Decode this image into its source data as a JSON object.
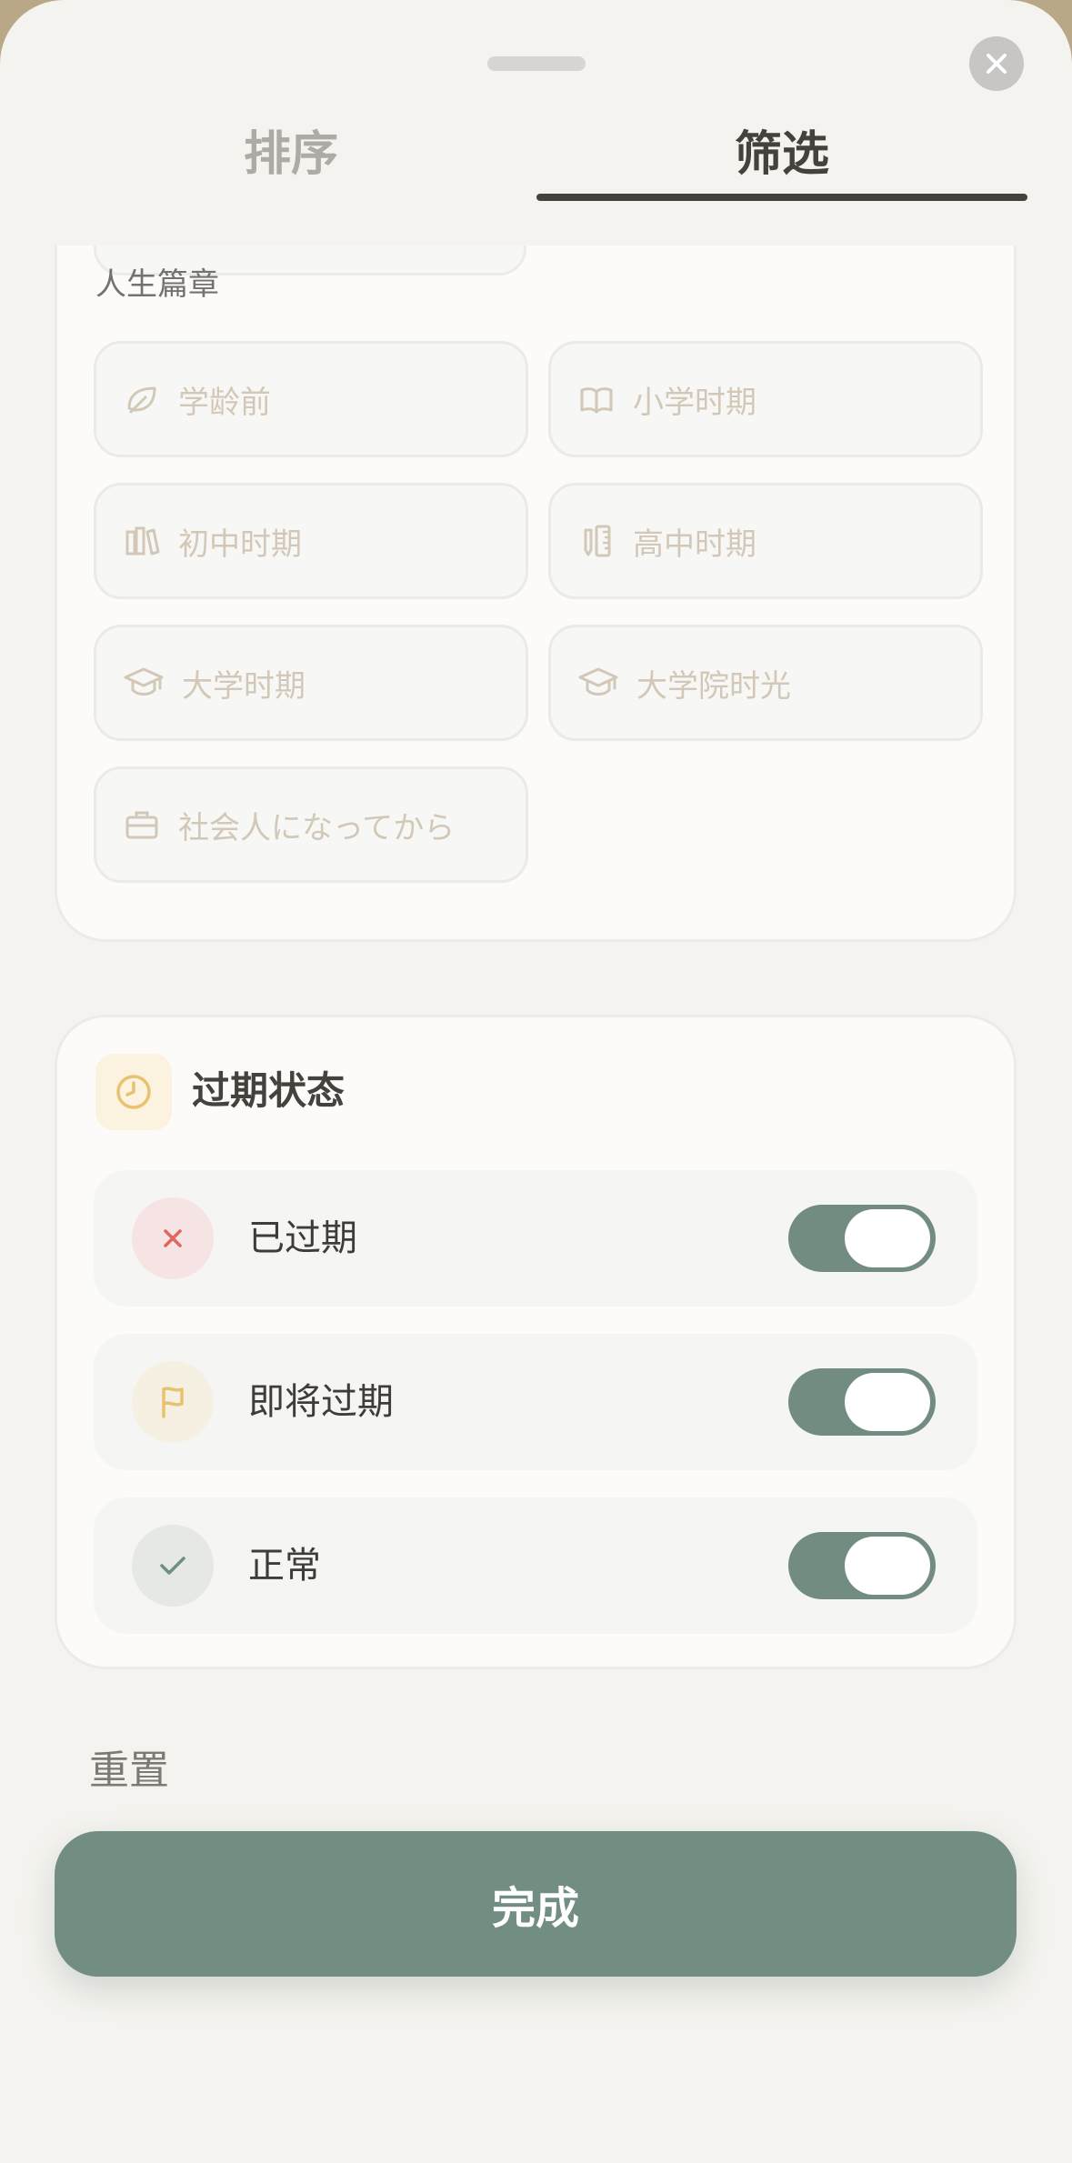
{
  "tabs": [
    {
      "label": "排序",
      "active": false
    },
    {
      "label": "筛选",
      "active": true
    }
  ],
  "chapters": {
    "title": "人生篇章",
    "items": [
      {
        "label": "学龄前",
        "icon": "leaf-icon"
      },
      {
        "label": "小学时期",
        "icon": "book-open-icon"
      },
      {
        "label": "初中时期",
        "icon": "books-icon"
      },
      {
        "label": "高中时期",
        "icon": "pencil-ruler-icon"
      },
      {
        "label": "大学时期",
        "icon": "graduation-cap-icon"
      },
      {
        "label": "大学院时光",
        "icon": "graduation-cap-icon"
      },
      {
        "label": "社会人になってから",
        "icon": "briefcase-icon"
      }
    ]
  },
  "expiry": {
    "title": "过期状态",
    "icon": "clock-icon",
    "rows": [
      {
        "label": "已过期",
        "icon": "x-icon",
        "enabled": true
      },
      {
        "label": "即将过期",
        "icon": "flag-icon",
        "enabled": true
      },
      {
        "label": "正常",
        "icon": "check-icon",
        "enabled": true
      }
    ]
  },
  "actions": {
    "reset_label": "重置",
    "done_label": "完成"
  },
  "colors": {
    "accent": "#728d82",
    "text_dark": "#45423e",
    "chip_text": "#d3c8b8",
    "expired": "#e06660",
    "soon": "#e8c270",
    "normal": "#6f8f84"
  }
}
